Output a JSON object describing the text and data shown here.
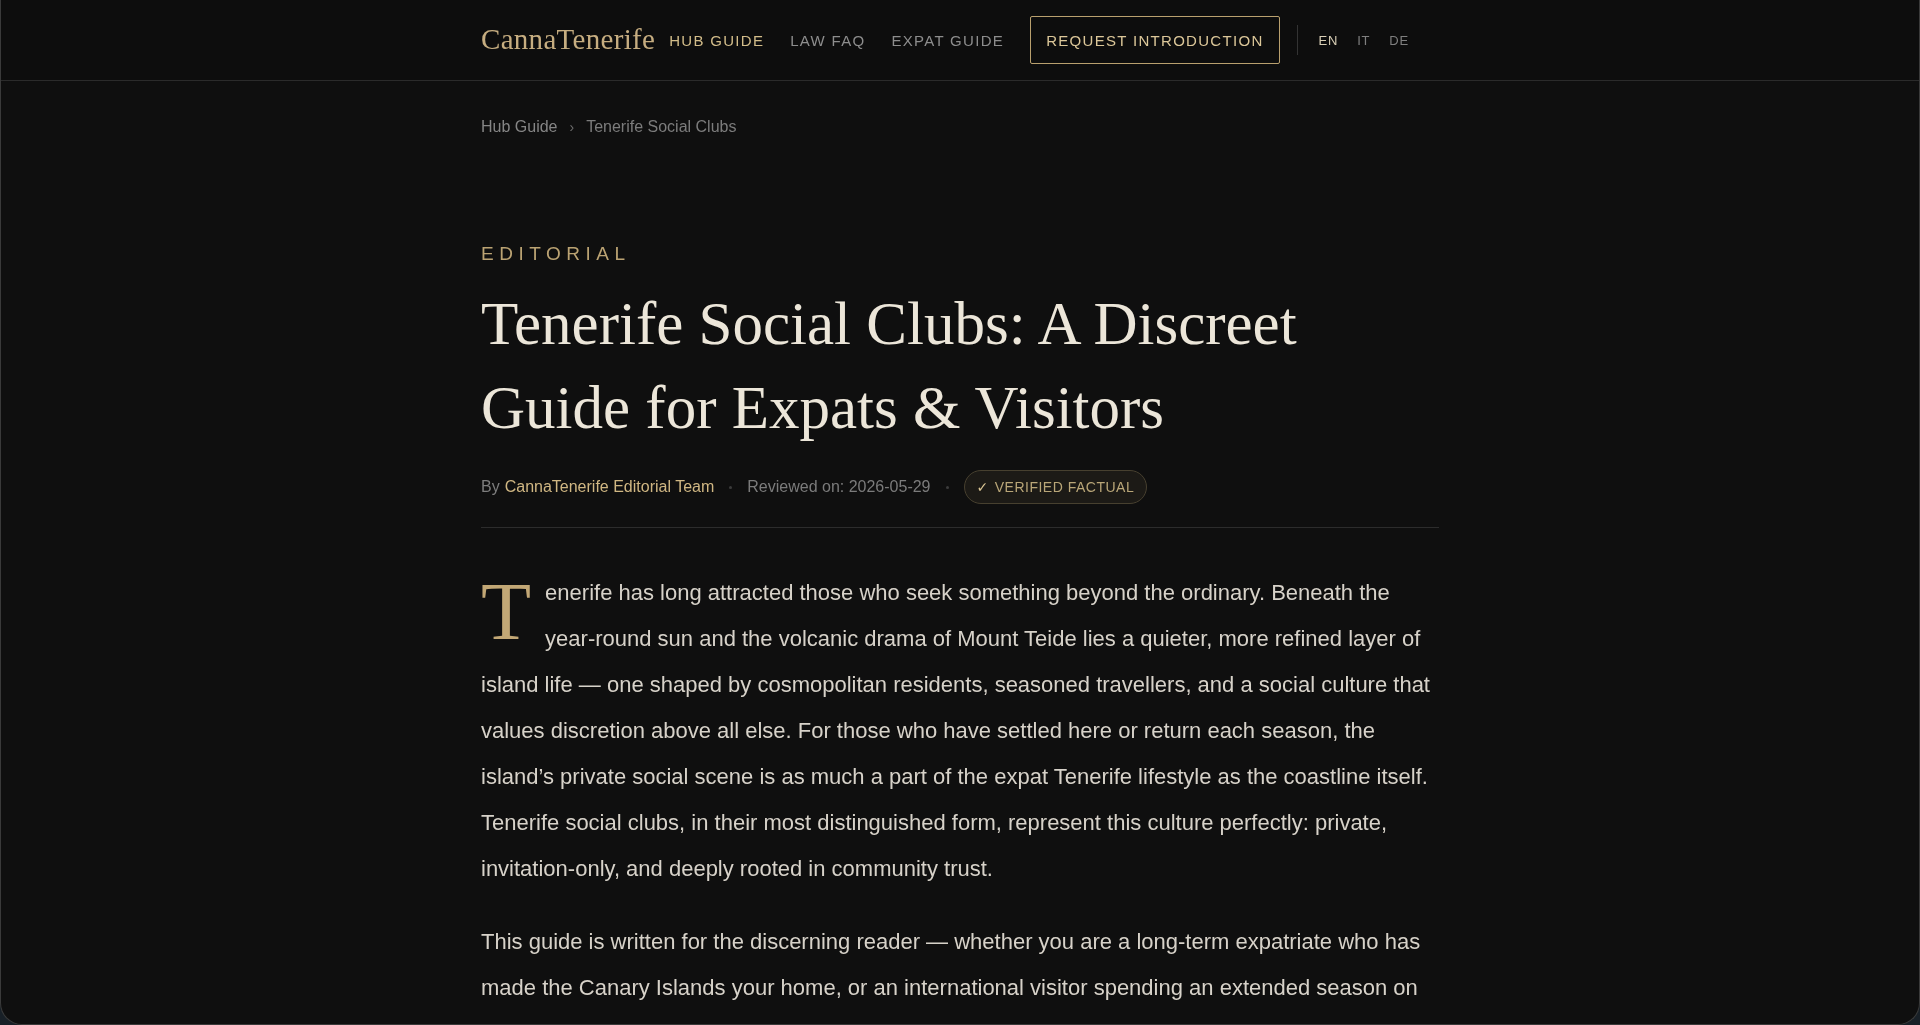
{
  "header": {
    "logo": "CannaTenerife",
    "nav": [
      {
        "label": "HUB GUIDE",
        "selected": true
      },
      {
        "label": "LAW FAQ",
        "selected": false
      },
      {
        "label": "EXPAT GUIDE",
        "selected": false
      }
    ],
    "cta_button": "REQUEST INTRODUCTION",
    "languages": [
      {
        "label": "EN",
        "selected": true
      },
      {
        "label": "IT",
        "selected": false
      },
      {
        "label": "DE",
        "selected": false
      }
    ]
  },
  "breadcrumb": {
    "items": [
      "Hub Guide",
      "Tenerife Social Clubs"
    ],
    "separator": "›"
  },
  "article": {
    "kicker": "EDITORIAL",
    "title": "Tenerife Social Clubs: A Discreet Guide for Expats & Visitors",
    "byline": {
      "prefix": "By",
      "author": "CannaTenerife Editorial Team"
    },
    "reviewed": "Reviewed on: 2026-05-29",
    "badge": {
      "icon": "✓",
      "label": "VERIFIED FACTUAL"
    },
    "paragraphs": [
      "Tenerife has long attracted those who seek something beyond the ordinary. Beneath the year-round sun and the volcanic drama of Mount Teide lies a quieter, more refined layer of island life — one shaped by cosmopolitan residents, seasoned travellers, and a social culture that values discretion above all else. For those who have settled here or return each season, the island’s private social scene is as much a part of the expat Tenerife lifestyle as the coastline itself. Tenerife social clubs, in their most distinguished form, represent this culture perfectly: private, invitation-only, and deeply rooted in community trust.",
      "This guide is written for the discerning reader — whether you are a long-term expatriate who has made the Canary Islands your home, or an international visitor spending an extended season on"
    ]
  }
}
